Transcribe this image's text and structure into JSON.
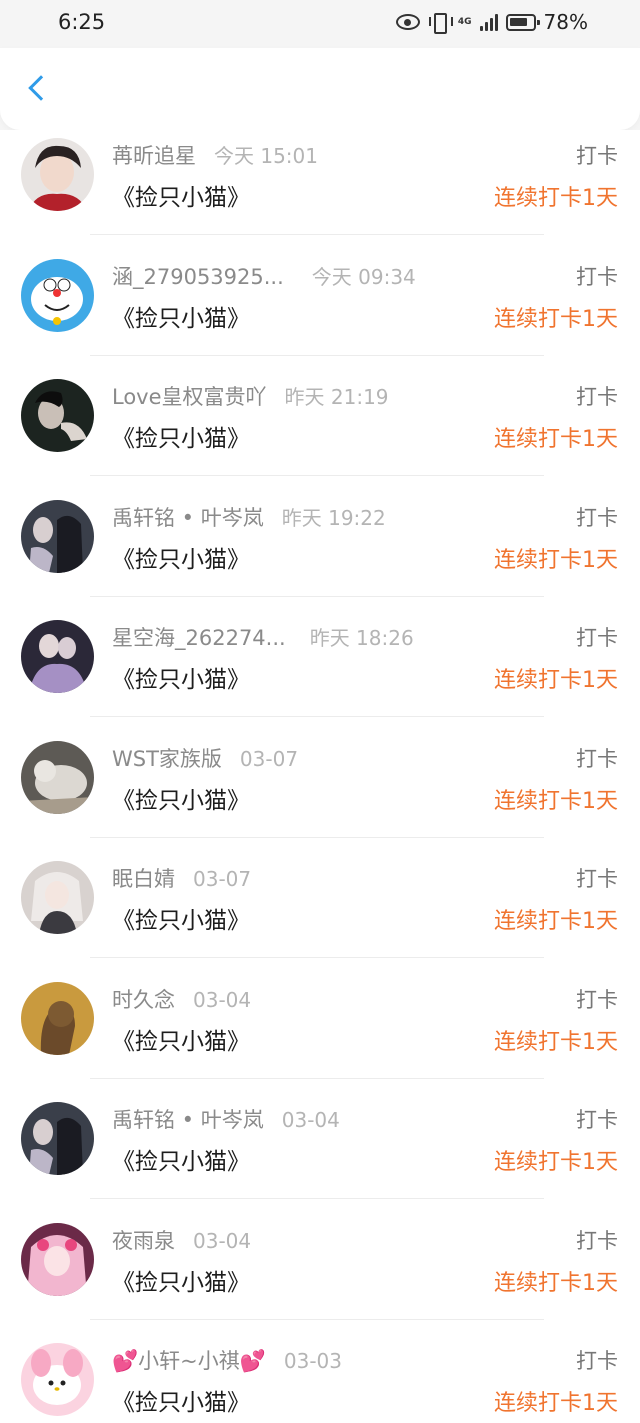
{
  "status_bar": {
    "time": "6:25",
    "network_label": "4G",
    "battery": "78%"
  },
  "header": {
    "back_icon": "chevron-left-icon",
    "accent_color": "#2f9be8"
  },
  "colors": {
    "streak": "#f0742f",
    "name": "#8a8a8a",
    "time": "#b4b4b4"
  },
  "list": {
    "items": [
      {
        "name": "苒昕追星",
        "time": "今天 15:01",
        "book": "《捡只小猫》",
        "action": "打卡",
        "streak": "连续打卡1天"
      },
      {
        "name": "涵_279053925...",
        "time": "今天 09:34",
        "book": "《捡只小猫》",
        "action": "打卡",
        "streak": "连续打卡1天"
      },
      {
        "name": "Love皇权富贵吖",
        "time": "昨天 21:19",
        "book": "《捡只小猫》",
        "action": "打卡",
        "streak": "连续打卡1天"
      },
      {
        "name": "禹轩铭 • 叶岑岚",
        "time": "昨天 19:22",
        "book": "《捡只小猫》",
        "action": "打卡",
        "streak": "连续打卡1天"
      },
      {
        "name": "星空海_262274...",
        "time": "昨天 18:26",
        "book": "《捡只小猫》",
        "action": "打卡",
        "streak": "连续打卡1天"
      },
      {
        "name": "WST家族版",
        "time": "03-07",
        "book": "《捡只小猫》",
        "action": "打卡",
        "streak": "连续打卡1天"
      },
      {
        "name": "眠白婧",
        "time": "03-07",
        "book": "《捡只小猫》",
        "action": "打卡",
        "streak": "连续打卡1天"
      },
      {
        "name": "时久念",
        "time": "03-04",
        "book": "《捡只小猫》",
        "action": "打卡",
        "streak": "连续打卡1天"
      },
      {
        "name": "禹轩铭 • 叶岑岚",
        "time": "03-04",
        "book": "《捡只小猫》",
        "action": "打卡",
        "streak": "连续打卡1天"
      },
      {
        "name": "夜雨泉",
        "time": "03-04",
        "book": "《捡只小猫》",
        "action": "打卡",
        "streak": "连续打卡1天"
      },
      {
        "name": "💕小轩~小祺💕",
        "time": "03-03",
        "book": "《捡只小猫》",
        "action": "打卡",
        "streak": "连续打卡1天"
      }
    ]
  }
}
